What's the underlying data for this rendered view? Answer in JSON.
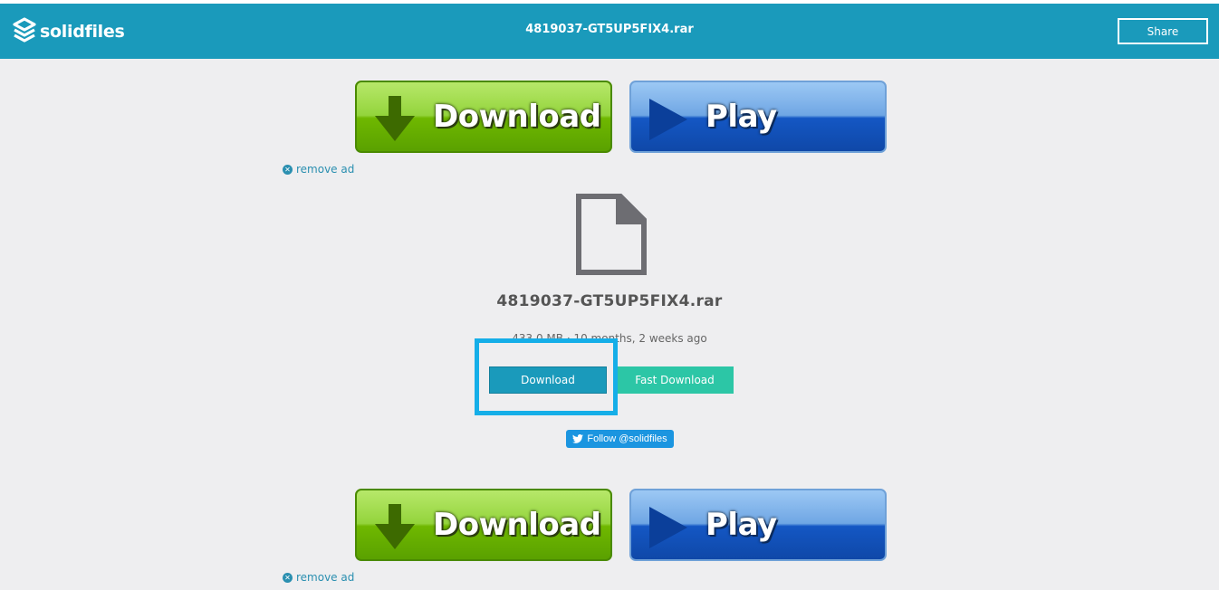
{
  "header": {
    "logo_text": "solidfiles",
    "title": "4819037-GT5UP5FIX4.rar",
    "share_label": "Share"
  },
  "ads": {
    "download_label": "Download",
    "play_label": "Play",
    "remove_ad_label": "remove ad"
  },
  "file": {
    "icon": "file-icon",
    "name": "4819037-GT5UP5FIX4.rar",
    "meta": "433.0 MB · 10 months, 2 weeks ago"
  },
  "actions": {
    "download_label": "Download",
    "fast_download_label": "Fast Download"
  },
  "social": {
    "follow_label": "Follow @solidfiles"
  },
  "colors": {
    "brand": "#1a9abb",
    "fast_download": "#2cc6a6",
    "highlight": "#15aee8",
    "twitter": "#1b95e0"
  }
}
